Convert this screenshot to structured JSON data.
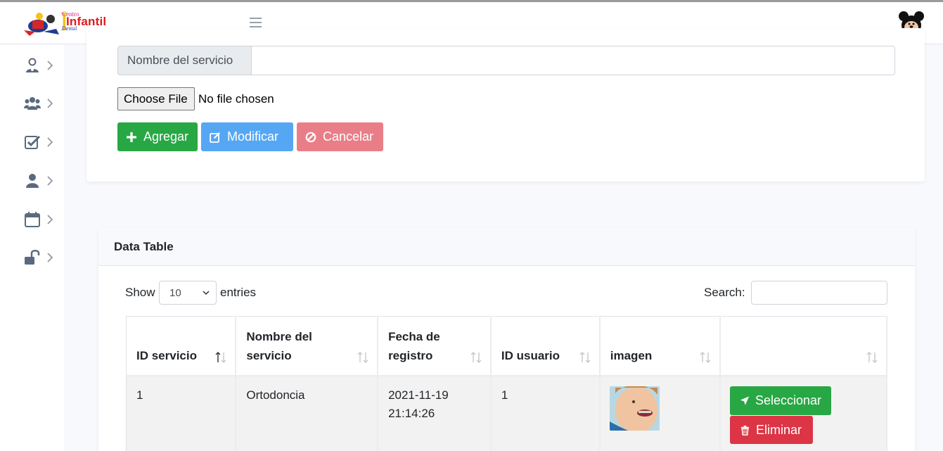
{
  "header": {
    "logo": {
      "word_top": "Centro",
      "word_bottom": "Dental",
      "word_main": "Infantil"
    },
    "menu_icon": "hamburger-icon",
    "avatar_icon": "mickey-avatar",
    "online_color": "#28a745"
  },
  "sidebar": {
    "items": [
      {
        "icon": "user-doctor-icon"
      },
      {
        "icon": "users-icon"
      },
      {
        "icon": "check-square-icon"
      },
      {
        "icon": "user-icon"
      },
      {
        "icon": "calendar-icon"
      },
      {
        "icon": "unlock-icon"
      }
    ]
  },
  "form": {
    "service_name_label": "Nombre del servicio",
    "service_name_value": "",
    "file_button": "Choose File",
    "file_status": "No file chosen",
    "add_label": "Agregar",
    "modify_label": "Modificar",
    "cancel_label": "Cancelar"
  },
  "table_card": {
    "title": "Data Table",
    "show_label": "Show",
    "entries_value": "10",
    "entries_label": "entries",
    "search_label": "Search:",
    "search_value": "",
    "columns": [
      {
        "label": "ID servicio"
      },
      {
        "label": "Nombre del servicio"
      },
      {
        "label": "Fecha de registro"
      },
      {
        "label": "ID usuario"
      },
      {
        "label": "imagen"
      },
      {
        "label": ""
      }
    ],
    "rows": [
      {
        "id_servicio": "1",
        "nombre": "Ortodoncia",
        "fecha": "2021-11-19 21:14:26",
        "id_usuario": "1",
        "imagen": "child-with-braces-photo",
        "select_label": "Seleccionar",
        "delete_label": "Eliminar"
      }
    ]
  },
  "colors": {
    "success": "#28a745",
    "info": "#56a7f3",
    "danger_light": "#ea7e88",
    "danger": "#dc3545"
  }
}
